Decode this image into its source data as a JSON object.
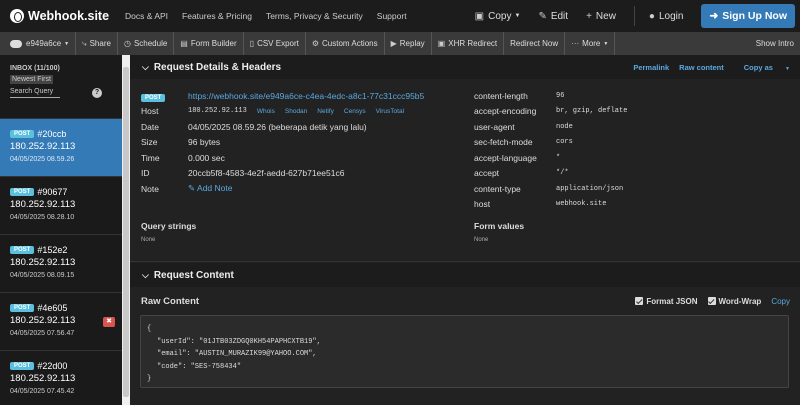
{
  "nav": {
    "logo": "Webhook.site",
    "links": [
      "Docs & API",
      "Features & Pricing",
      "Terms, Privacy & Security",
      "Support"
    ],
    "copy": "Copy",
    "edit": "Edit",
    "new": "New",
    "login": "Login",
    "signup": "Sign Up Now"
  },
  "toolbar": {
    "token": "e949a6ce",
    "items": [
      "Share",
      "Schedule",
      "Form Builder",
      "CSV Export",
      "Custom Actions",
      "Replay",
      "XHR Redirect",
      "Redirect Now",
      "More"
    ],
    "show_intro": "Show Intro"
  },
  "sidebar": {
    "inbox": "INBOX (11/100)",
    "newest": "Newest First",
    "search": "Search Query",
    "requests": [
      {
        "method": "POST",
        "id": "#20ccb",
        "ip": "180.252.92.113",
        "date": "04/05/2025 08.59.26",
        "active": true
      },
      {
        "method": "POST",
        "id": "#90677",
        "ip": "180.252.92.113",
        "date": "04/05/2025 08.28.10"
      },
      {
        "method": "POST",
        "id": "#152e2",
        "ip": "180.252.92.113",
        "date": "04/05/2025 08.09.15"
      },
      {
        "method": "POST",
        "id": "#4e605",
        "ip": "180.252.92.113",
        "date": "04/05/2025 07.56.47"
      },
      {
        "method": "POST",
        "id": "#22d00",
        "ip": "180.252.92.113",
        "date": "04/05/2025 07.45.42"
      }
    ]
  },
  "details": {
    "title": "Request Details & Headers",
    "actions": [
      "Permalink",
      "Raw content",
      "Copy as"
    ],
    "method": "POST",
    "url": "https://webhook.site/e949a6ce-c4ea-4edc-a8c1-77c31ccc95b5",
    "host_label": "Host",
    "host_value": "180.252.92.113",
    "host_links": [
      "Whois",
      "Shodan",
      "Netify",
      "Censys",
      "VirusTotal"
    ],
    "date_label": "Date",
    "date_value": "04/05/2025 08.59.26 (beberapa detik yang lalu)",
    "size_label": "Size",
    "size_value": "96 bytes",
    "time_label": "Time",
    "time_value": "0.000 sec",
    "id_label": "ID",
    "id_value": "20ccb5f8-4583-4e2f-aedd-627b71ee51c6",
    "note_label": "Note",
    "add_note": "Add Note",
    "headers": [
      {
        "k": "content-length",
        "v": "96"
      },
      {
        "k": "accept-encoding",
        "v": "br, gzip, deflate"
      },
      {
        "k": "user-agent",
        "v": "node"
      },
      {
        "k": "sec-fetch-mode",
        "v": "cors"
      },
      {
        "k": "accept-language",
        "v": "*"
      },
      {
        "k": "accept",
        "v": "*/*"
      },
      {
        "k": "content-type",
        "v": "application/json"
      },
      {
        "k": "host",
        "v": "webhook.site"
      }
    ],
    "query_strings": "Query strings",
    "query_none": "None",
    "form_values": "Form values",
    "form_none": "None"
  },
  "content": {
    "title": "Request Content",
    "raw": "Raw Content",
    "format_json": "Format JSON",
    "word_wrap": "Word-Wrap",
    "copy": "Copy",
    "lines": [
      "{",
      "\"userId\": \"01JTB03ZDGQ0KH54PAPHCXTB19\",",
      "\"email\": \"AUSTIN_MURAZIK99@YAHOO.COM\",",
      "\"code\": \"SES-758434\"",
      "}"
    ]
  }
}
